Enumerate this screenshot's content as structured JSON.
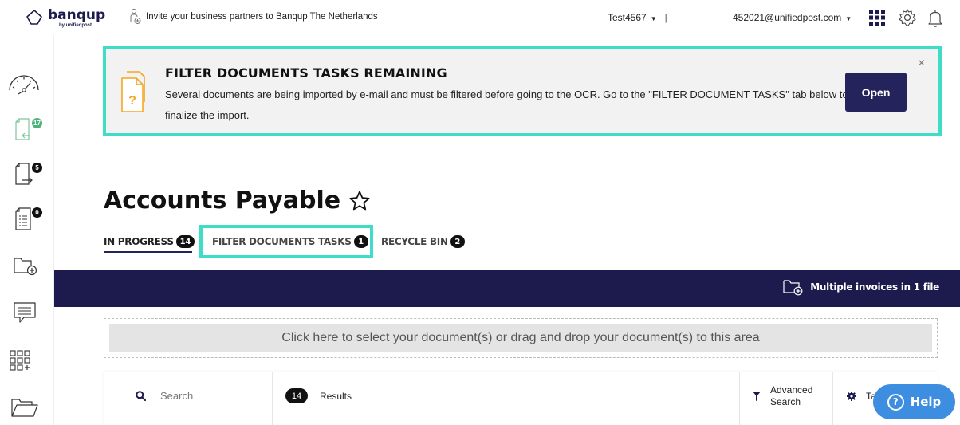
{
  "header": {
    "logo_text": "banqup",
    "logo_sub": "by unifiedpost",
    "invite_text": "Invite your business partners to Banqup The Netherlands",
    "company": "Test4567",
    "email": "452021@unifiedpost.com"
  },
  "sidebar": {
    "items": [
      {
        "icon": "dashboard-gauge-icon",
        "badge": ""
      },
      {
        "icon": "incoming-documents-icon",
        "badge": "17"
      },
      {
        "icon": "outgoing-documents-icon",
        "badge": "5"
      },
      {
        "icon": "document-list-icon",
        "badge": "0"
      },
      {
        "icon": "add-folder-icon",
        "badge": ""
      },
      {
        "icon": "messages-icon",
        "badge": ""
      },
      {
        "icon": "apps-add-icon",
        "badge": ""
      },
      {
        "icon": "open-folder-icon",
        "badge": ""
      }
    ]
  },
  "banner": {
    "title": "FILTER DOCUMENTS TASKS REMAINING",
    "message": "Several documents are being imported by e-mail and must be filtered before going to the OCR. Go to the \"FILTER DOCUMENT TASKS\" tab below to finalize the import.",
    "open_label": "Open",
    "close_label": "×"
  },
  "page": {
    "title": "Accounts Payable"
  },
  "tabs": [
    {
      "label": "IN PROGRESS",
      "count": "14"
    },
    {
      "label": "FILTER DOCUMENTS TASKS",
      "count": "1"
    },
    {
      "label": "RECYCLE BIN",
      "count": "2"
    }
  ],
  "strip": {
    "multi_label": "Multiple invoices in 1 file"
  },
  "dropzone": {
    "text": "Click here to select your document(s) or drag and drop your document(s) to this area"
  },
  "results_bar": {
    "search_placeholder": "Search",
    "results_count": "14",
    "results_label": "Results",
    "advanced_line1": "Advanced",
    "advanced_line2": "Search",
    "table_label": "Ta"
  },
  "help": {
    "label": "Help"
  },
  "colors": {
    "primary": "#1d1a4d",
    "highlight": "#3fdcc8",
    "help": "#3d8de0"
  }
}
